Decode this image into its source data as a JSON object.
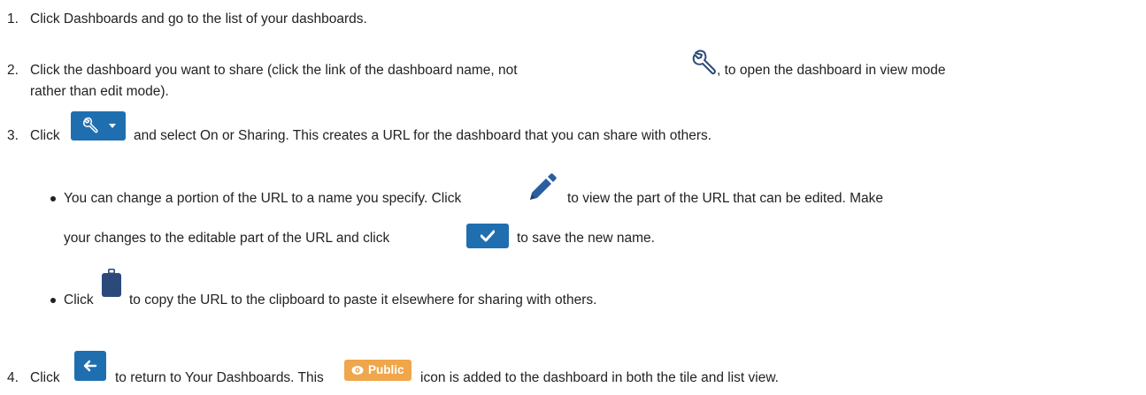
{
  "steps": [
    {
      "number": "1.",
      "lines": [
        "Click Dashboards and go to the list of your dashboards."
      ]
    },
    {
      "number": "2.",
      "text_before_icon": "Click the dashboard you want to share (click the link of the dashboard name, not",
      "text_after_icon": ", to open the dashboard in view mode",
      "continuation": "rather than edit mode)."
    },
    {
      "number": "3.",
      "text_before_button": "Click",
      "text_after_button": "and select On or Sharing. This creates a URL for the dashboard that you can share with others.",
      "bullets": [
        {
          "part1": "You can change a portion of the URL to a name you specify. Click",
          "part2": "to view the part of the URL that can be edited. Make",
          "part3": "your changes to the editable part of the URL and click",
          "part4": "to save the new name."
        },
        {
          "part1": "Click",
          "part2": "to copy the URL to the clipboard to paste it elsewhere for sharing with others."
        }
      ]
    },
    {
      "number": "4.",
      "part1": "Click",
      "part2": "to return to Your Dashboards. This",
      "part3": "icon is added to the dashboard in both the tile and list view.",
      "public_badge_label": "Public"
    }
  ],
  "icons": {
    "wrench": "wrench-icon",
    "tools_dropdown": "tools-dropdown-button",
    "pencil": "pencil-icon",
    "check": "check-button",
    "clipboard": "clipboard-icon",
    "back": "back-arrow-button",
    "public": "public-badge"
  },
  "colors": {
    "button_blue": "#1f6fb0",
    "badge_orange": "#f0a64a",
    "icon_navy": "#2b4a7a",
    "text": "#222222"
  }
}
